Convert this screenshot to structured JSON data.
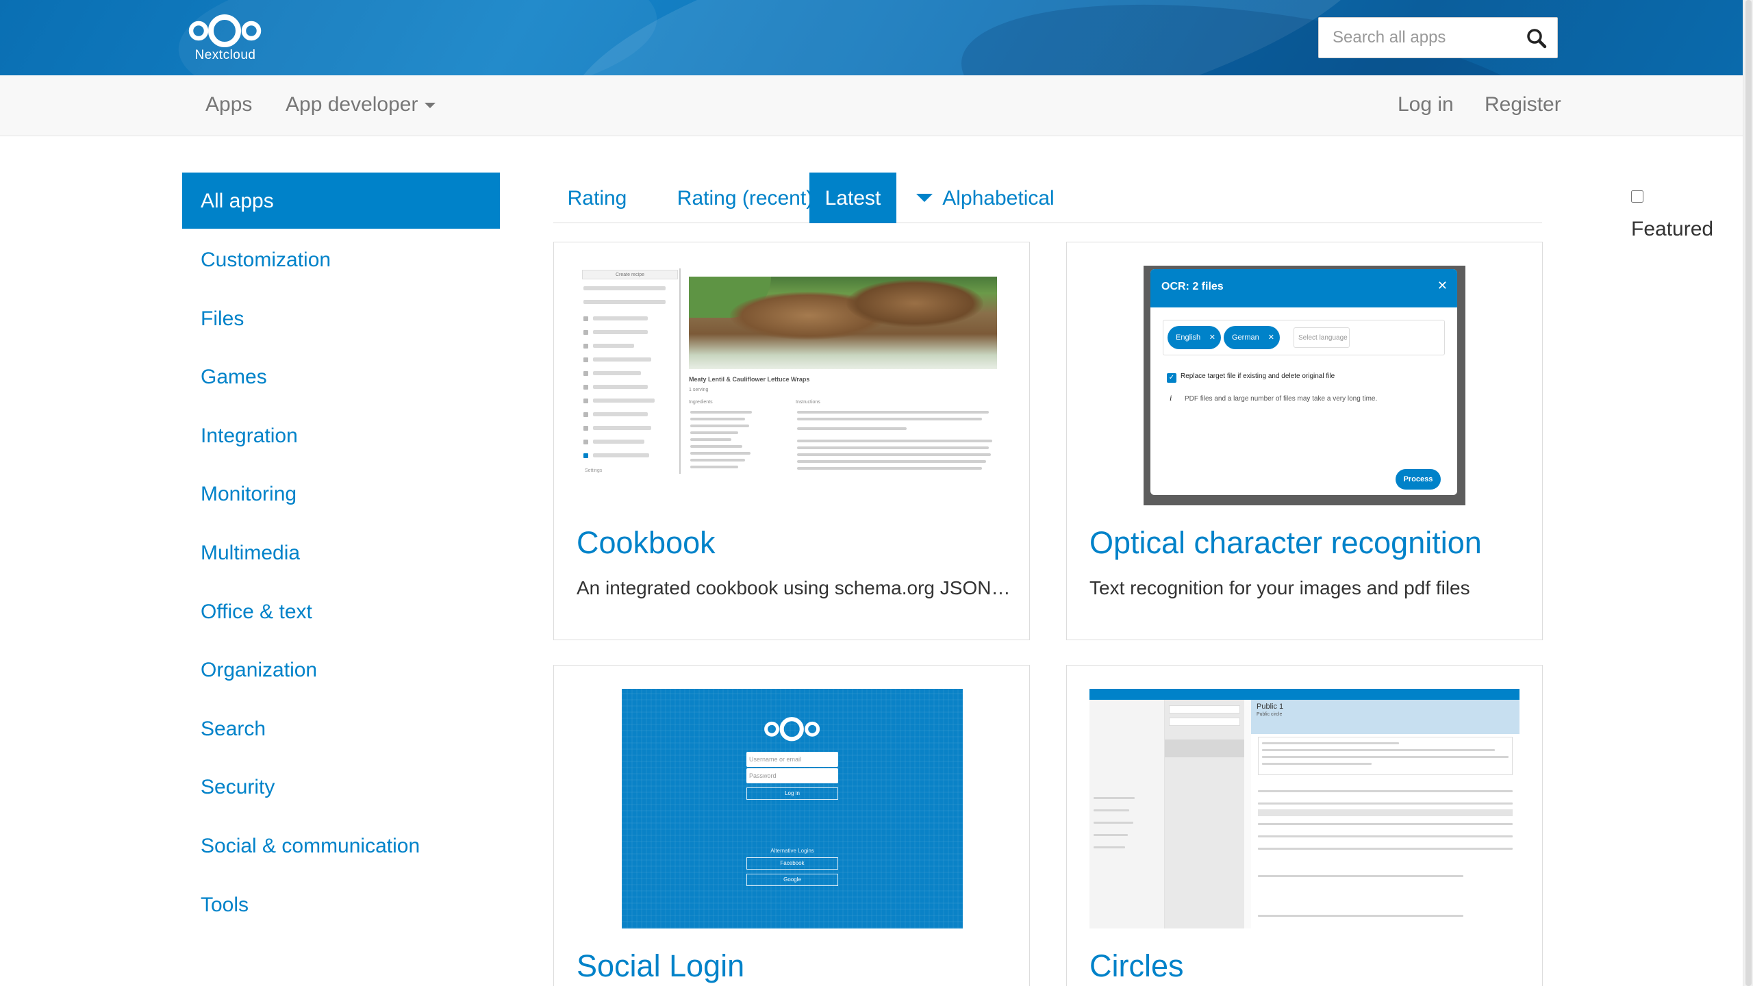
{
  "brand": {
    "name": "Nextcloud"
  },
  "search": {
    "placeholder": "Search all apps"
  },
  "topnav": {
    "apps": "Apps",
    "app_developer": "App developer",
    "login": "Log in",
    "register": "Register"
  },
  "sidebar": {
    "items": [
      {
        "label": "All apps",
        "active": true
      },
      {
        "label": "Customization"
      },
      {
        "label": "Files"
      },
      {
        "label": "Games"
      },
      {
        "label": "Integration"
      },
      {
        "label": "Monitoring"
      },
      {
        "label": "Multimedia"
      },
      {
        "label": "Office & text"
      },
      {
        "label": "Organization"
      },
      {
        "label": "Search"
      },
      {
        "label": "Security"
      },
      {
        "label": "Social & communication"
      },
      {
        "label": "Tools"
      }
    ]
  },
  "sort_tabs": {
    "rating": "Rating",
    "rating_recent": "Rating (recent)",
    "latest": "Latest",
    "alphabetical": "Alphabetical",
    "active": "Latest",
    "featured_label": "Featured",
    "featured_checked": false
  },
  "apps": [
    {
      "title": "Cookbook",
      "description": "An integrated cookbook using schema.org JSON …",
      "screenshot": {
        "create_recipe": "Create recipe",
        "recipe_title": "Meaty Lentil & Cauliflower Lettuce Wraps",
        "servings": "1 serving",
        "ingredients": "Ingredients",
        "instructions": "Instructions",
        "settings": "Settings"
      }
    },
    {
      "title": "Optical character recognition",
      "description": "Text recognition for your images and pdf files",
      "screenshot": {
        "dialog_title": "OCR: 2 files",
        "languages": [
          "English",
          "German"
        ],
        "select_placeholder": "Select language",
        "replace_option": "Replace target file if existing and delete original file",
        "info": "PDF files and a large number of files may take a very long time.",
        "process_button": "Process"
      }
    },
    {
      "title": "Social Login",
      "description": "",
      "screenshot": {
        "username_placeholder": "Username or email",
        "password_placeholder": "Password",
        "login_button": "Log in",
        "alternative_logins": "Alternative Logins",
        "providers": [
          "Facebook",
          "Google"
        ]
      }
    },
    {
      "title": "Circles",
      "description": "",
      "screenshot": {
        "circle_name": "Public 1",
        "circle_type": "Public circle"
      }
    }
  ],
  "colors": {
    "accent": "#0082c9",
    "header": "#0b72b9",
    "nav_bg": "#f8f8f8"
  }
}
